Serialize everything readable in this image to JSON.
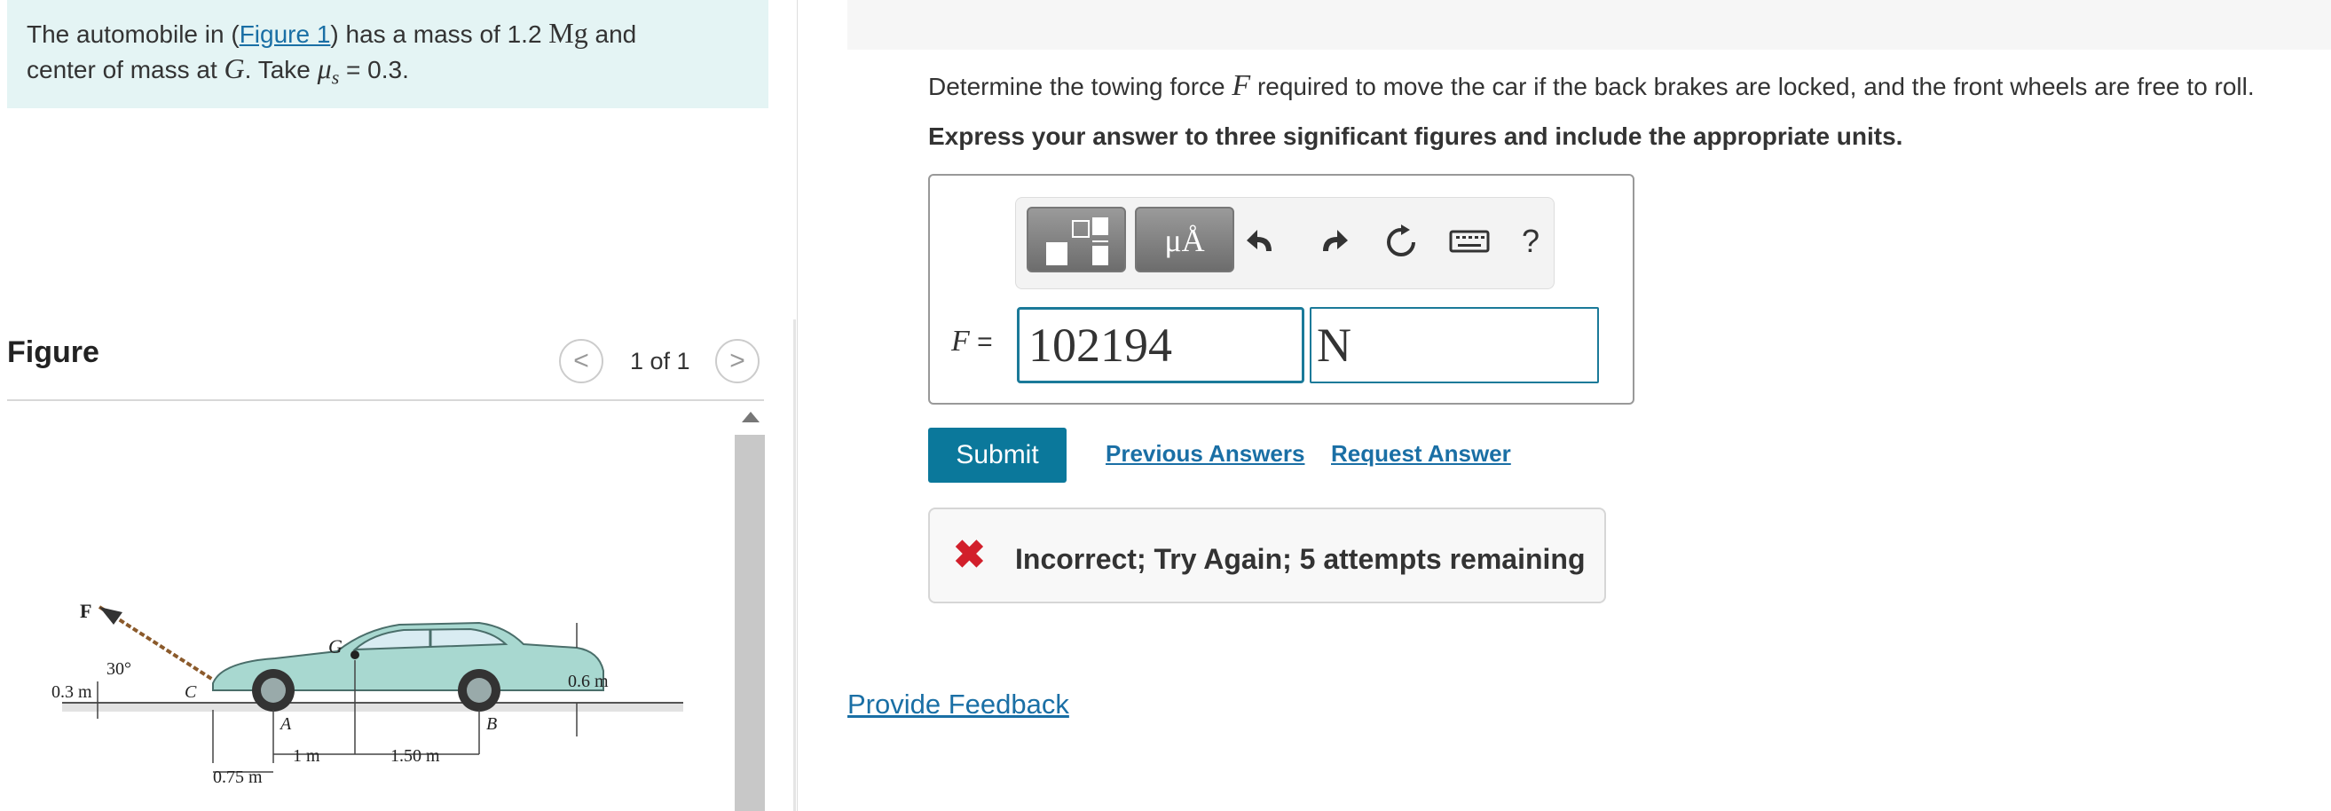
{
  "problem": {
    "prefix": "The automobile in (",
    "figure_link": "Figure 1",
    "mid": ") has a mass of 1.2 ",
    "mass_unit": "Mg",
    "suffix1": " and",
    "line2_prefix": "center of mass at ",
    "cm_symbol": "G",
    "line2_mid": ". Take ",
    "mu_symbol": "μ",
    "mu_subscript": "s",
    "mu_value": " = 0.3."
  },
  "figure": {
    "title": "Figure",
    "page": "1 of 1",
    "prev": "<",
    "next": ">",
    "labels": {
      "F": "F",
      "angle": "30°",
      "height_left": "0.3 m",
      "C": "C",
      "G": "G",
      "A": "A",
      "B": "B",
      "height_right": "0.6 m",
      "d1": "1 m",
      "d2": "1.50 m",
      "d0": "0.75 m"
    }
  },
  "question": {
    "text_before": "Determine the towing force ",
    "symbol": "F",
    "text_after": " required to move the car if the back brakes are locked, and the front wheels are free to roll.",
    "instruction": "Express your answer to three significant figures and include the appropriate units."
  },
  "toolbar": {
    "units_btn_label": "μÅ",
    "undo_icon": "undo-icon",
    "redo_icon": "redo-icon",
    "reset_icon": "reset-icon",
    "keyboard_icon": "keyboard-icon",
    "help_label": "?"
  },
  "answer": {
    "label_symbol": "F",
    "label_eq": " =",
    "value": "102194",
    "unit": "N"
  },
  "actions": {
    "submit": "Submit",
    "previous_answers": "Previous Answers",
    "request_answer": "Request Answer"
  },
  "feedback": {
    "icon": "x-icon",
    "message": "Incorrect; Try Again; 5 attempts remaining"
  },
  "footer": {
    "provide_feedback": "Provide Feedback"
  },
  "colors": {
    "accent": "#0b789b",
    "problem_bg": "#e4f4f4",
    "error": "#d21f2b",
    "car": "#a8d8d0"
  }
}
